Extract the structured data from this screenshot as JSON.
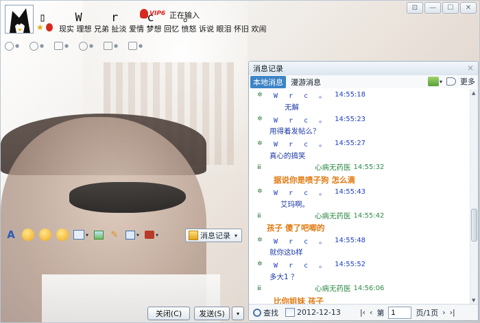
{
  "window": {
    "controls": [
      "⊡",
      "—",
      "☐",
      "✕"
    ]
  },
  "profile": {
    "nickname": "▯ W r c 。",
    "vip_label": "VIP6",
    "status": "正在输入",
    "signature": "现实 理想 兄弟 扯淡 爱情 梦想 回忆 愤怒 诉说 眼泪 怀旧 欢闹"
  },
  "toolbar": {
    "close_label": "关闭(C)",
    "send_label": "发送(S)",
    "send_arrow": "▾",
    "message_record_label": "消息记录"
  },
  "history": {
    "title": "消息记录",
    "close": "×",
    "tabs": [
      {
        "label": "本地消息",
        "active": true
      },
      {
        "label": "漫游消息",
        "active": false
      }
    ],
    "more_label": "更多",
    "rows": [
      {
        "kind": "header",
        "side": "a",
        "sender": "W r c 。",
        "time": "14:55:18"
      },
      {
        "kind": "msg",
        "text": "无解",
        "indent": 40,
        "style": "normal"
      },
      {
        "kind": "header",
        "side": "a",
        "sender": "W r c 。",
        "time": "14:55:23"
      },
      {
        "kind": "msg",
        "text": "用得着发帖么？",
        "indent": 18,
        "style": "normal"
      },
      {
        "kind": "header",
        "side": "a",
        "sender": "W r c 。",
        "time": "14:55:27"
      },
      {
        "kind": "msg",
        "text": "真心的搞笑",
        "indent": 18,
        "style": "normal"
      },
      {
        "kind": "header",
        "side": "b",
        "sender": "心病无药医",
        "time": "14:55:32"
      },
      {
        "kind": "msg",
        "text": "据说你是喷子狗 怎么滴",
        "indent": 24,
        "style": "orange"
      },
      {
        "kind": "header",
        "side": "a",
        "sender": "W r c 。",
        "time": "14:55:43"
      },
      {
        "kind": "msg",
        "text": "艾玛啊。",
        "indent": 34,
        "style": "normal"
      },
      {
        "kind": "header",
        "side": "b",
        "sender": "心病无药医",
        "time": "14:55:42"
      },
      {
        "kind": "msg",
        "text": "孩子 傻了吧唧的",
        "indent": 14,
        "style": "orange"
      },
      {
        "kind": "header",
        "side": "a",
        "sender": "W r c 。",
        "time": "14:55:48"
      },
      {
        "kind": "msg",
        "text": "就你这b样",
        "indent": 18,
        "style": "normal"
      },
      {
        "kind": "header",
        "side": "a",
        "sender": "W r c 。",
        "time": "14:55:52"
      },
      {
        "kind": "msg",
        "text": "多大1 ？",
        "indent": 18,
        "style": "normal"
      },
      {
        "kind": "header",
        "side": "b",
        "sender": "心病无药医",
        "time": "14:56:06"
      },
      {
        "kind": "msg",
        "text": "比你姐妹 孩子",
        "indent": 24,
        "style": "orange"
      }
    ],
    "footer": {
      "search_label": "查找",
      "date": "2012-12-13",
      "page_prefix": "第",
      "page_value": "1",
      "page_suffix": "页/1页"
    }
  },
  "colors": {
    "accent": "#3c84c6",
    "sender_self": "#1a3dbf",
    "sender_other": "#2d8a45",
    "orange_message": "#e07a10"
  },
  "icons": [
    "avatar-cartoon",
    "star-icon",
    "qq-penguin-icon",
    "camera-icon",
    "mic-icon",
    "transfer-icon",
    "add-friend-icon",
    "screen-icon",
    "note-icon",
    "font-icon",
    "smiley-icon",
    "picture-icon",
    "calendar-icon",
    "search-icon",
    "speaker-icon"
  ]
}
